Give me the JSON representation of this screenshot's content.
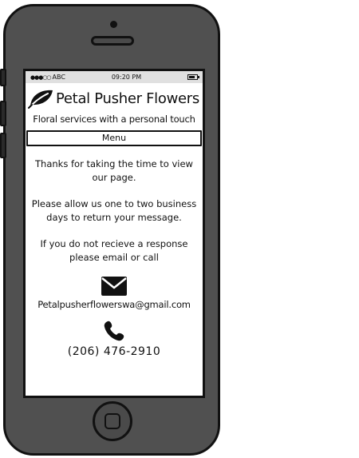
{
  "status_bar": {
    "signal": "●●●○○",
    "carrier": "ABC",
    "time": "09:20 PM"
  },
  "header": {
    "brand": "Petal Pusher Flowers",
    "logo_icon": "leaf-icon"
  },
  "tagline": "Floral services with a personal touch",
  "menu": {
    "label": "Menu"
  },
  "message": {
    "line1": "Thanks for taking the time to view our page.",
    "line2": "Please allow us one to two business days to return your message.",
    "line3": "If you do not recieve a response please email or call"
  },
  "contact": {
    "email_icon": "envelope-icon",
    "email": "Petalpusherflowerswa@gmail.com",
    "phone_icon": "phone-handset-icon",
    "phone": "(206) 476-2910"
  },
  "colors": {
    "phone_body": "#505050",
    "outline": "#111111",
    "screen": "#ffffff",
    "status_bar": "#e0e0e0"
  }
}
